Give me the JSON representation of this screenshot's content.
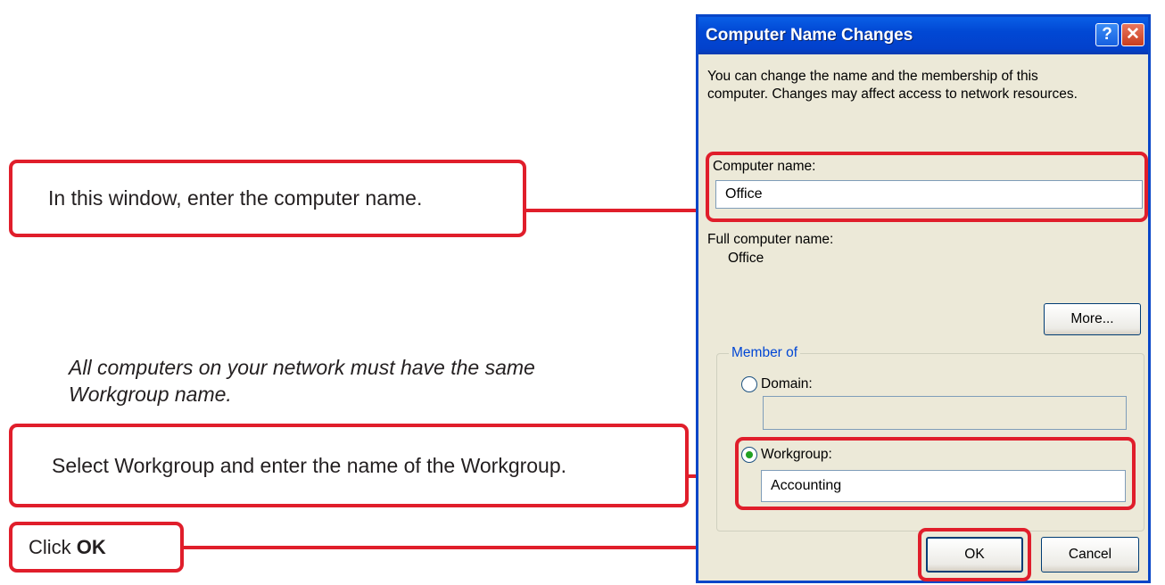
{
  "callouts": {
    "computer_name": "In this window, enter the computer name.",
    "workgroup": "Select Workgroup and enter the name of the Workgroup.",
    "click_prefix": "Click ",
    "click_bold": "OK"
  },
  "note": {
    "line1": "All computers on your network must have the same",
    "line2": "Workgroup name."
  },
  "dialog": {
    "title": "Computer Name Changes",
    "help_glyph": "?",
    "close_glyph": "✕",
    "description_line1": "You can change the name and the membership of this",
    "description_line2": "computer. Changes may affect access to network resources.",
    "computer_name_label": "Computer name:",
    "computer_name_value": "Office",
    "full_name_label": "Full computer name:",
    "full_name_value": "Office",
    "more_button": "More...",
    "member_of_label": "Member of",
    "domain_label": "Domain:",
    "domain_value": "",
    "workgroup_label": "Workgroup:",
    "workgroup_value": "Accounting",
    "selected_membership": "Workgroup",
    "ok_button": "OK",
    "cancel_button": "Cancel"
  },
  "colors": {
    "highlight": "#e01e2b",
    "titlebar": "#0148d4",
    "dialog_bg": "#ece9d8"
  }
}
